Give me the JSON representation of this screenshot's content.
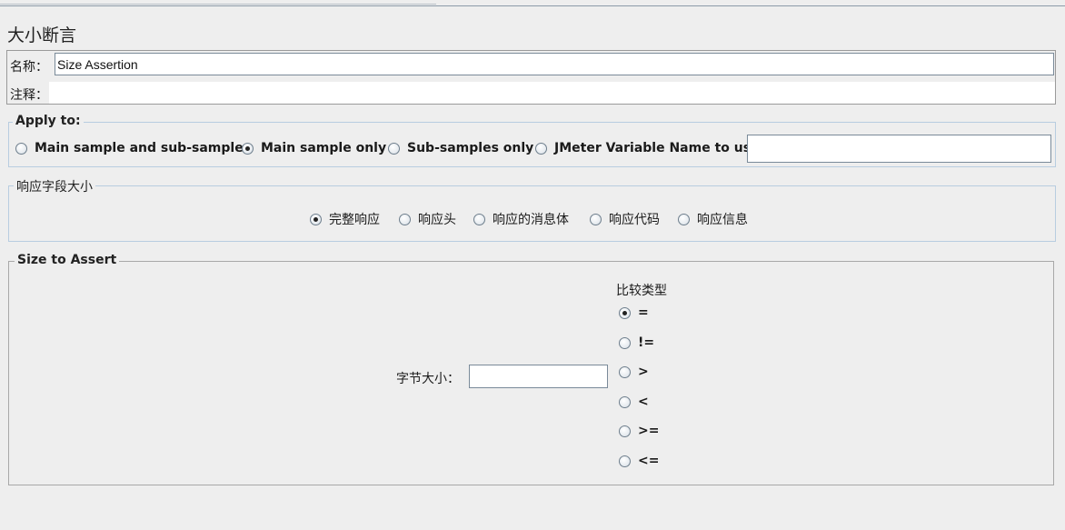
{
  "page": {
    "title": "大小断言"
  },
  "name_panel": {
    "name_label": "名称：",
    "name_value": "Size Assertion",
    "comment_label": "注释：",
    "comment_value": ""
  },
  "apply_to": {
    "legend": "Apply to:",
    "options": [
      "Main sample and sub-samples",
      "Main sample only",
      "Sub-samples only",
      "JMeter Variable Name to use"
    ],
    "selected": "Main sample only",
    "variable_value": ""
  },
  "response_field": {
    "legend": "响应字段大小",
    "options": [
      "完整响应",
      "响应头",
      "响应的消息体",
      "响应代码",
      "响应信息"
    ],
    "selected": "完整响应"
  },
  "size_to_assert": {
    "legend": "Size to Assert",
    "size_label": "字节大小：",
    "size_value": "",
    "comparison_title": "比较类型",
    "operators": [
      "=",
      "!=",
      ">",
      "<",
      ">=",
      "<="
    ],
    "selected": "="
  },
  "colors": {
    "background": "#eeeeee",
    "group_border": "#b8cde0",
    "field_border": "#7a8a99"
  }
}
